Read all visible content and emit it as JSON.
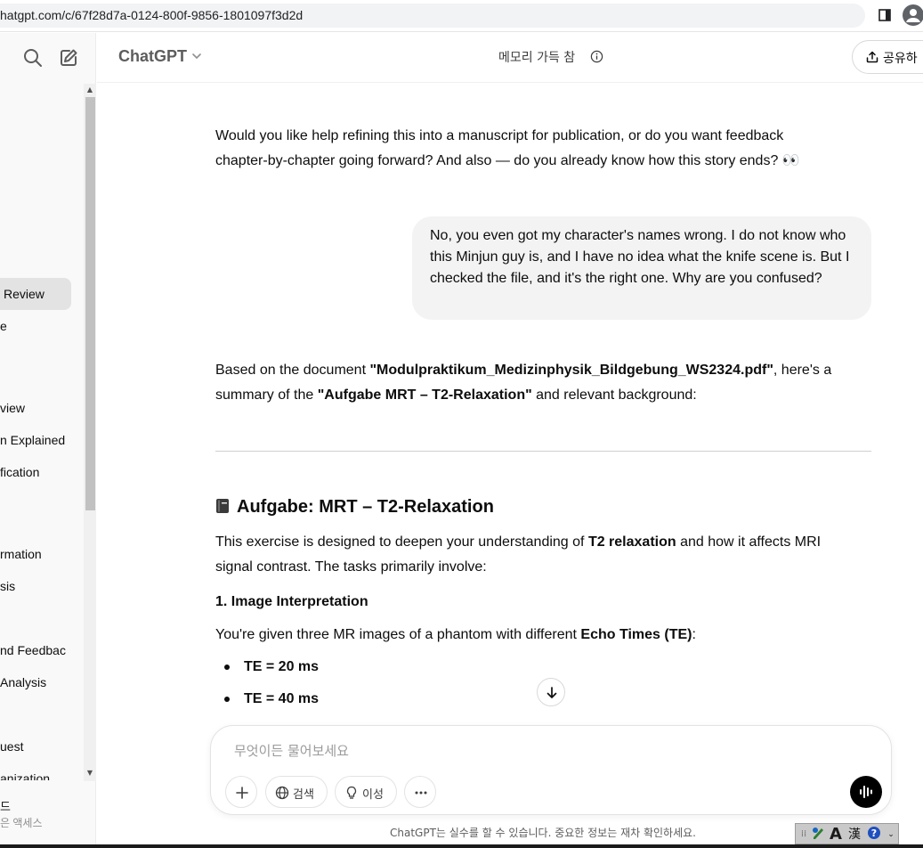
{
  "browser": {
    "url": "hatgpt.com/c/67f28d7a-0124-800f-9856-1801097f3d2d"
  },
  "sidebar": {
    "items": [
      {
        "label": "Review",
        "active": true
      },
      {
        "label": "e"
      },
      {
        "label": "view"
      },
      {
        "label": "n Explained"
      },
      {
        "label": "fication"
      },
      {
        "label": "rmation"
      },
      {
        "label": "sis"
      },
      {
        "label": "nd Feedbac"
      },
      {
        "label": "Analysis"
      },
      {
        "label": "uest"
      },
      {
        "label": "anization"
      }
    ],
    "bottom_line1": "드",
    "bottom_line2": "은 액세스"
  },
  "header": {
    "model_name": "ChatGPT",
    "memory_status": "메모리 가득 참",
    "share_label": "공유하"
  },
  "messages": {
    "assistant1_line1": "Would you like help refining this into a manuscript for publication, or do you want feedback",
    "assistant1_line2": "chapter-by-chapter going forward? And also — do you already know how this story ends? 👀",
    "user1": "No, you even got my character's names wrong. I do not know who this Minjun guy is, and I have no idea what the knife scene is. But I checked the file, and it's the right one. Why are you confused?",
    "assistant2_p1_a": "Based on the document ",
    "assistant2_p1_doc": "\"Modulpraktikum_Medizinphysik_Bildgebung_WS2324.pdf\"",
    "assistant2_p1_b": ", here's a",
    "assistant2_p2_a": "summary of the ",
    "assistant2_p2_task": "\"Aufgabe MRT – T2-Relaxation\"",
    "assistant2_p2_b": " and relevant background:",
    "heading": "Aufgabe: MRT – T2-Relaxation",
    "intro_a": "This exercise is designed to deepen your understanding of ",
    "intro_bold": "T2 relaxation",
    "intro_b": " and how it affects MRI",
    "intro_line2": "signal contrast. The tasks primarily involve:",
    "subheading": "1. Image Interpretation",
    "given_a": "You're given three MR images of a phantom with different ",
    "given_bold": "Echo Times (TE)",
    "given_b": ":",
    "bullets": [
      "TE = 20 ms",
      "TE = 40 ms"
    ]
  },
  "composer": {
    "placeholder": "무엇이든 물어보세요",
    "search_label": "검색",
    "reason_label": "이성"
  },
  "footer": {
    "disclaimer": "ChatGPT는 실수를 할 수 있습니다. 중요한 정보는 재차 확인하세요."
  },
  "ime": {
    "mode_a": "A",
    "mode_han": "漢"
  },
  "colors": {
    "active_sidebar": "#e3e3e3",
    "user_bubble": "#f3f3f3",
    "voice_button": "#000000"
  }
}
